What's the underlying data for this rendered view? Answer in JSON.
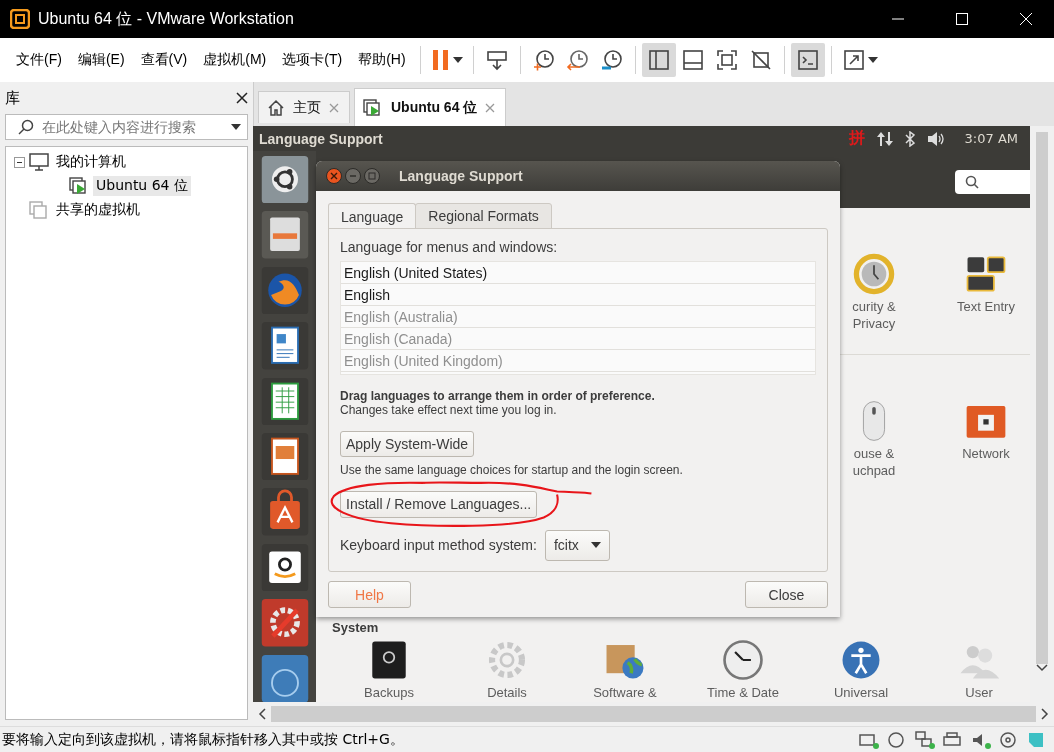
{
  "window": {
    "title": "Ubuntu 64 位 - VMware Workstation"
  },
  "menu": [
    "文件(F)",
    "编辑(E)",
    "查看(V)",
    "虚拟机(M)",
    "选项卡(T)",
    "帮助(H)"
  ],
  "toolbar": [
    {
      "kind": "pause",
      "menu": true,
      "pressed": false
    },
    {
      "kind": "separator"
    },
    {
      "kind": "send-keys",
      "menu": false,
      "pressed": false
    },
    {
      "kind": "separator"
    },
    {
      "kind": "snapshot",
      "menu": false,
      "pressed": false
    },
    {
      "kind": "revert",
      "menu": false,
      "pressed": false
    },
    {
      "kind": "snapshot-manager",
      "menu": false,
      "pressed": false
    },
    {
      "kind": "separator"
    },
    {
      "kind": "sidebar",
      "menu": false,
      "pressed": true
    },
    {
      "kind": "thumbnails",
      "menu": false,
      "pressed": false
    },
    {
      "kind": "fullscreen",
      "menu": false,
      "pressed": false
    },
    {
      "kind": "unity",
      "menu": false,
      "pressed": false
    },
    {
      "kind": "separator"
    },
    {
      "kind": "console",
      "menu": false,
      "pressed": true
    },
    {
      "kind": "separator"
    },
    {
      "kind": "stretch",
      "menu": true,
      "pressed": false
    }
  ],
  "library": {
    "title": "库",
    "search": {
      "placeholder": "在此处键入内容进行搜索"
    },
    "tree": [
      {
        "label": "我的计算机",
        "kind": "computer",
        "selected": false,
        "expanded": true,
        "children": [
          {
            "label": "Ubuntu 64 位",
            "kind": "vm",
            "selected": true
          }
        ]
      },
      {
        "label": "共享的虚拟机",
        "kind": "shared",
        "selected": false
      }
    ]
  },
  "tabs": [
    {
      "label": "主页",
      "kind": "home",
      "selected": false
    },
    {
      "label": "Ubuntu 64 位",
      "kind": "vm",
      "selected": true
    }
  ],
  "vm": {
    "top_panel": {
      "title": "Language Support",
      "input_method": "拼",
      "clock": "3:07 AM"
    },
    "launcher": [
      {
        "kind": "dash"
      },
      {
        "kind": "files"
      },
      {
        "kind": "firefox"
      },
      {
        "kind": "writer"
      },
      {
        "kind": "calc"
      },
      {
        "kind": "impress"
      },
      {
        "kind": "software"
      },
      {
        "kind": "amazon"
      },
      {
        "kind": "settings"
      },
      {
        "kind": "disk"
      }
    ],
    "settings": {
      "rows": [
        {
          "items": [
            {
              "label": "curity &\nPrivacy",
              "kind": "security"
            },
            {
              "label": "Text Entry",
              "kind": "text-entry"
            }
          ]
        },
        {
          "items": [
            {
              "label": "ouse &\nuchpad",
              "kind": "mouse"
            },
            {
              "label": "Network",
              "kind": "network"
            }
          ]
        }
      ],
      "section": "System",
      "system_items": [
        {
          "label": "Backups",
          "kind": "backups"
        },
        {
          "label": "Details",
          "kind": "details"
        },
        {
          "label": "Software &",
          "kind": "software"
        },
        {
          "label": "Time & Date",
          "kind": "time"
        },
        {
          "label": "Universal",
          "kind": "universal"
        },
        {
          "label": "User",
          "kind": "user"
        }
      ]
    },
    "dialog": {
      "title": "Language Support",
      "tabs": [
        {
          "label": "Language",
          "selected": true
        },
        {
          "label": "Regional Formats",
          "selected": false
        }
      ],
      "list_label": "Language for menus and windows:",
      "languages": [
        {
          "label": "English (United States)",
          "disabled": false
        },
        {
          "label": "English",
          "disabled": false
        },
        {
          "label": "English (Australia)",
          "disabled": true
        },
        {
          "label": "English (Canada)",
          "disabled": true
        },
        {
          "label": "English (United Kingdom)",
          "disabled": true
        }
      ],
      "hint_bold": "Drag languages to arrange them in order of preference.",
      "hint": "Changes take effect next time you log in.",
      "apply_button": "Apply System-Wide",
      "apply_note": "Use the same language choices for startup and the login screen.",
      "install_button": "Install / Remove Languages...",
      "input_label": "Keyboard input method system:",
      "input_method": "fcitx",
      "help_button": "Help",
      "close_button": "Close"
    }
  },
  "status_bar": {
    "message": "要将输入定向到该虚拟机，请将鼠标指针移入其中或按 Ctrl+G。",
    "devices": [
      {
        "kind": "disk",
        "connected": true
      },
      {
        "kind": "cd",
        "connected": false
      },
      {
        "kind": "network",
        "connected": true
      },
      {
        "kind": "printer",
        "connected": false
      },
      {
        "kind": "sound",
        "connected": true
      },
      {
        "kind": "usb",
        "connected": false
      },
      {
        "kind": "message",
        "connected": false
      }
    ]
  }
}
